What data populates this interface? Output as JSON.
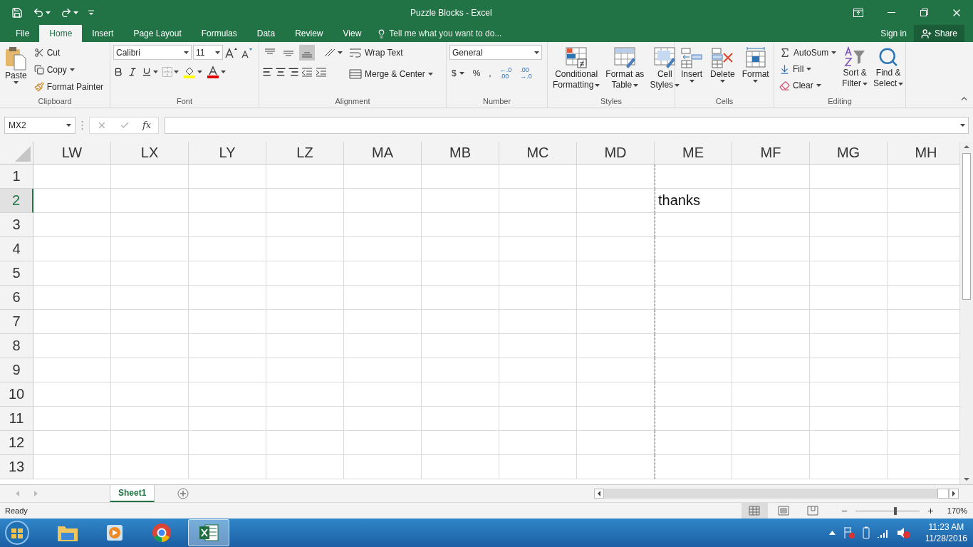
{
  "window": {
    "title": "Puzzle Blocks - Excel"
  },
  "menu_tabs": [
    {
      "label": "File",
      "selected": false
    },
    {
      "label": "Home",
      "selected": true
    },
    {
      "label": "Insert",
      "selected": false
    },
    {
      "label": "Page Layout",
      "selected": false
    },
    {
      "label": "Formulas",
      "selected": false
    },
    {
      "label": "Data",
      "selected": false
    },
    {
      "label": "Review",
      "selected": false
    },
    {
      "label": "View",
      "selected": false
    }
  ],
  "tell_me": {
    "placeholder": "Tell me what you want to do..."
  },
  "account": {
    "sign_in": "Sign in",
    "share": "Share"
  },
  "ribbon": {
    "clipboard": {
      "label": "Clipboard",
      "paste": "Paste",
      "cut": "Cut",
      "copy": "Copy",
      "format_painter": "Format Painter"
    },
    "font": {
      "label": "Font",
      "font_name": "Calibri",
      "font_size": "11"
    },
    "alignment": {
      "label": "Alignment",
      "wrap_text": "Wrap Text",
      "merge_center": "Merge & Center",
      "bottom_align_selected": true
    },
    "number": {
      "label": "Number",
      "format": "General",
      "currency": "$",
      "percent": "%",
      "comma": ",",
      "increase_decimal": [
        "←.0",
        ".00"
      ],
      "decrease_decimal": [
        ".00",
        "→.0"
      ]
    },
    "styles": {
      "label": "Styles",
      "buttons": [
        {
          "line1": "Conditional",
          "line2": "Formatting"
        },
        {
          "line1": "Format as",
          "line2": "Table"
        },
        {
          "line1": "Cell",
          "line2": "Styles"
        }
      ]
    },
    "cells": {
      "label": "Cells",
      "buttons": [
        "Insert",
        "Delete",
        "Format"
      ]
    },
    "editing": {
      "label": "Editing",
      "autosum": "AutoSum",
      "fill": "Fill",
      "clear": "Clear",
      "buttons": [
        {
          "line1": "Sort &",
          "line2": "Filter"
        },
        {
          "line1": "Find &",
          "line2": "Select"
        }
      ]
    }
  },
  "formula_bar": {
    "name_box": "MX2",
    "function_label": "fx"
  },
  "grid": {
    "columns": [
      {
        "label": "LW",
        "page_break": false
      },
      {
        "label": "LX",
        "page_break": false
      },
      {
        "label": "LY",
        "page_break": false
      },
      {
        "label": "LZ",
        "page_break": false
      },
      {
        "label": "MA",
        "page_break": false
      },
      {
        "label": "MB",
        "page_break": false
      },
      {
        "label": "MC",
        "page_break": false
      },
      {
        "label": "MD",
        "page_break": false
      },
      {
        "label": "ME",
        "page_break": true
      },
      {
        "label": "MF",
        "page_break": false
      },
      {
        "label": "MG",
        "page_break": false
      },
      {
        "label": "MH",
        "page_break": false
      }
    ],
    "rows": [
      {
        "label": "1",
        "selected": false
      },
      {
        "label": "2",
        "selected": true,
        "cells": [
          {
            "kind": "empty"
          },
          {
            "kind": "empty"
          },
          {
            "kind": "empty"
          },
          {
            "kind": "empty"
          },
          {
            "kind": "empty"
          },
          {
            "kind": "empty"
          },
          {
            "kind": "empty"
          },
          {
            "kind": "empty"
          },
          {
            "kind": "text",
            "text": "thanks"
          }
        ]
      },
      {
        "label": "3",
        "selected": false
      },
      {
        "label": "4",
        "selected": false
      },
      {
        "label": "5",
        "selected": false
      },
      {
        "label": "6",
        "selected": false
      },
      {
        "label": "7",
        "selected": false
      },
      {
        "label": "8",
        "selected": false
      },
      {
        "label": "9",
        "selected": false
      },
      {
        "label": "10",
        "selected": false
      },
      {
        "label": "11",
        "selected": false
      },
      {
        "label": "12",
        "selected": false
      },
      {
        "label": "13",
        "selected": false
      }
    ]
  },
  "sheet_tabs": [
    {
      "label": "Sheet1",
      "selected": true
    }
  ],
  "status_bar": {
    "status": "Ready",
    "views": [
      {
        "selected": true
      },
      {
        "selected": false
      },
      {
        "selected": false
      }
    ],
    "zoom": {
      "level": 0.62,
      "reading": "170%"
    }
  },
  "taskbar": {
    "apps": [
      {
        "selected": false
      },
      {
        "selected": false
      },
      {
        "selected": false
      },
      {
        "selected": true
      }
    ],
    "time": "11:23 AM",
    "date": "11/28/2016"
  }
}
